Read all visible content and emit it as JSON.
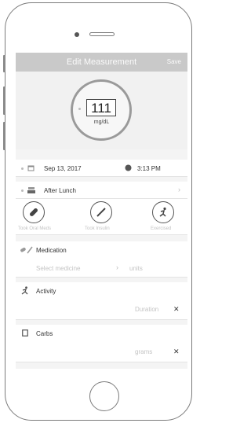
{
  "header": {
    "title": "Edit Measurement",
    "save_label": "Save"
  },
  "measurement": {
    "value": "111",
    "unit": "mg/dL"
  },
  "datetime": {
    "date": "Sep 13, 2017",
    "time": "3:13 PM"
  },
  "meal": {
    "label": "After Lunch"
  },
  "actions": [
    {
      "label": "Took Oral Meds"
    },
    {
      "label": "Took Insulin"
    },
    {
      "label": "Exercised"
    }
  ],
  "medication": {
    "title": "Medication",
    "select_placeholder": "Select medicine",
    "units_placeholder": "units"
  },
  "activity": {
    "title": "Activity",
    "duration_placeholder": "Duration"
  },
  "carbs": {
    "title": "Carbs",
    "placeholder": "grams"
  },
  "colors": {
    "nav_bar": "#c9c9c9",
    "ring": "#9a9a9a"
  }
}
